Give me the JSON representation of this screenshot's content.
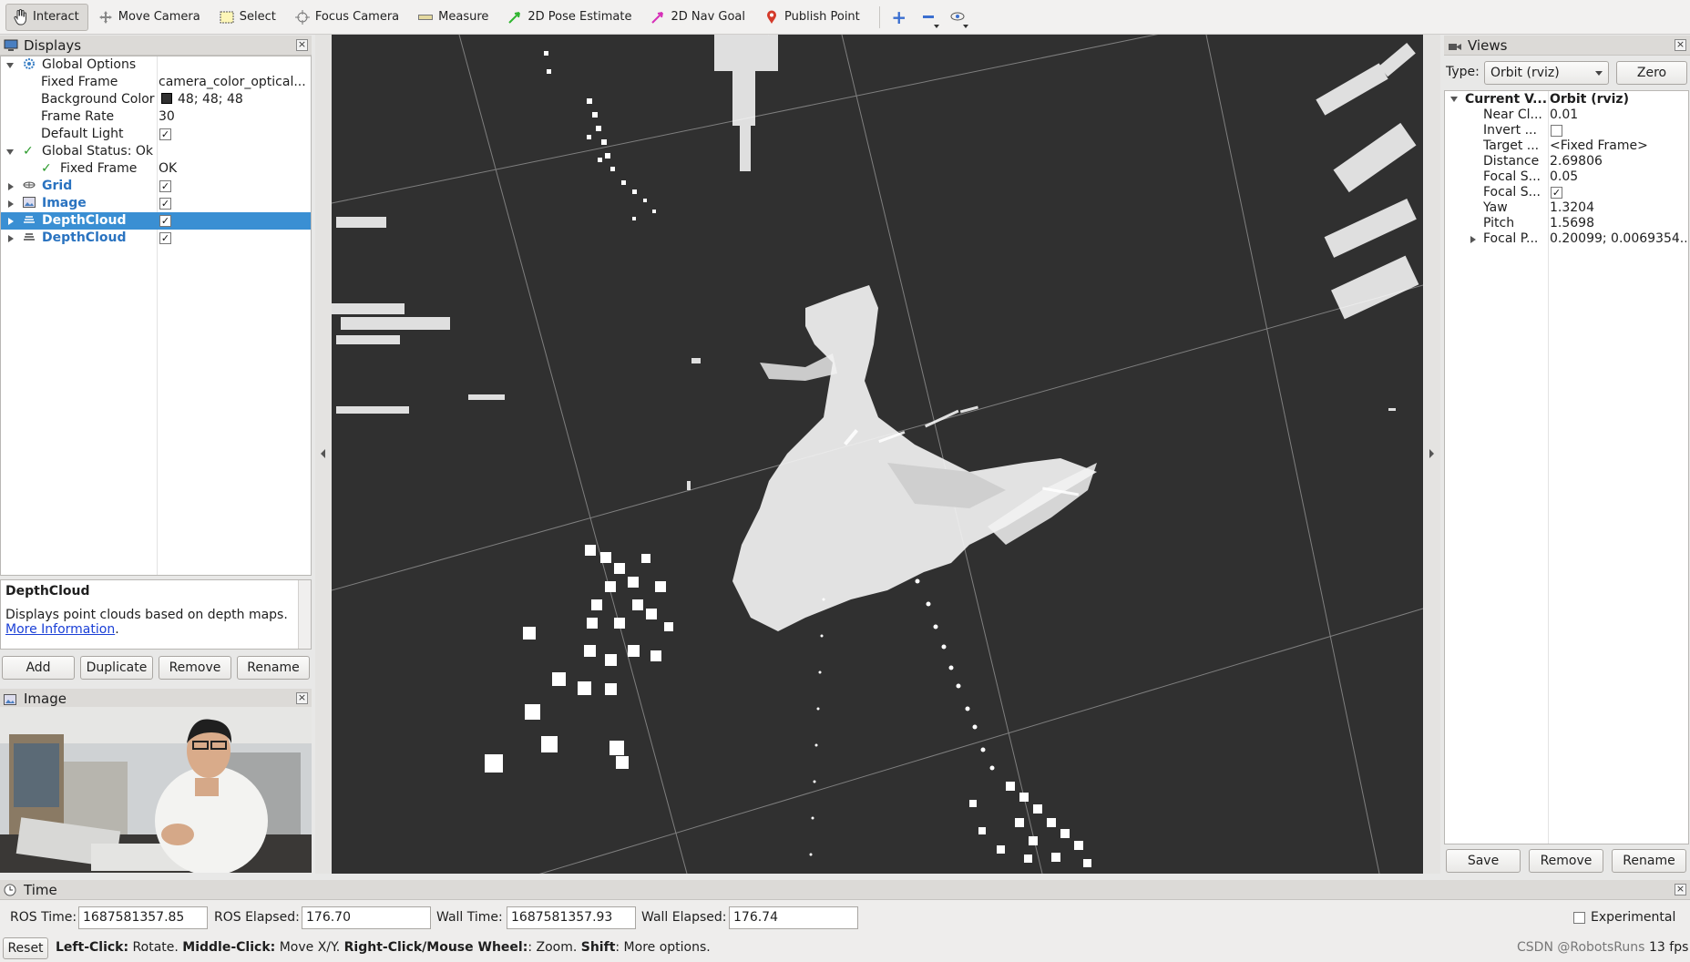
{
  "toolbar": {
    "tools": [
      {
        "label": "Interact",
        "icon": "hand-icon"
      },
      {
        "label": "Move Camera",
        "icon": "move-camera-icon"
      },
      {
        "label": "Select",
        "icon": "select-box-icon"
      },
      {
        "label": "Focus Camera",
        "icon": "focus-target-icon"
      },
      {
        "label": "Measure",
        "icon": "ruler-icon"
      },
      {
        "label": "2D Pose Estimate",
        "icon": "green-arrow-icon"
      },
      {
        "label": "2D Nav Goal",
        "icon": "magenta-arrow-icon"
      },
      {
        "label": "Publish Point",
        "icon": "red-pin-icon"
      }
    ],
    "active_tool": "Interact"
  },
  "displays": {
    "title": "Displays",
    "rows": [
      {
        "key": "Global Options",
        "value": ""
      },
      {
        "key": "Fixed Frame",
        "value": "camera_color_optical..."
      },
      {
        "key": "Background Color",
        "value": "48; 48; 48"
      },
      {
        "key": "Frame Rate",
        "value": "30"
      },
      {
        "key": "Default Light",
        "value": ""
      },
      {
        "key": "Global Status: Ok",
        "value": ""
      },
      {
        "key": "Fixed Frame",
        "value": "OK"
      },
      {
        "key": "Grid",
        "value": ""
      },
      {
        "key": "Image",
        "value": ""
      },
      {
        "key": "DepthCloud",
        "value": ""
      },
      {
        "key": "DepthCloud",
        "value": ""
      }
    ],
    "background_color_swatch": "#303030",
    "selected_row": "DepthCloud"
  },
  "description": {
    "title": "DepthCloud",
    "text": "Displays point clouds based on depth maps.",
    "link": "More Information",
    "link_suffix": "."
  },
  "display_buttons": {
    "add": "Add",
    "duplicate": "Duplicate",
    "remove": "Remove",
    "rename": "Rename"
  },
  "image_panel": {
    "title": "Image"
  },
  "views": {
    "title": "Views",
    "type_label": "Type:",
    "type_value": "Orbit (rviz)",
    "zero": "Zero",
    "rows": [
      {
        "key": "Current V...",
        "value": "Orbit (rviz)"
      },
      {
        "key": "Near Cl...",
        "value": "0.01"
      },
      {
        "key": "Invert ...",
        "value": ""
      },
      {
        "key": "Target ...",
        "value": "<Fixed Frame>"
      },
      {
        "key": "Distance",
        "value": "2.69806"
      },
      {
        "key": "Focal S...",
        "value": "0.05"
      },
      {
        "key": "Focal S...",
        "value": ""
      },
      {
        "key": "Yaw",
        "value": "1.3204"
      },
      {
        "key": "Pitch",
        "value": "1.5698"
      },
      {
        "key": "Focal P...",
        "value": "0.20099; 0.0069354..."
      }
    ],
    "buttons": {
      "save": "Save",
      "remove": "Remove",
      "rename": "Rename"
    }
  },
  "time": {
    "title": "Time",
    "ros_time_label": "ROS Time:",
    "ros_time": "1687581357.85",
    "ros_elapsed_label": "ROS Elapsed:",
    "ros_elapsed": "176.70",
    "wall_time_label": "Wall Time:",
    "wall_time": "1687581357.93",
    "wall_elapsed_label": "Wall Elapsed:",
    "wall_elapsed": "176.74",
    "experimental": "Experimental"
  },
  "status": {
    "reset": "Reset",
    "hint_left_click": "Left-Click:",
    "hint_rotate": " Rotate. ",
    "hint_middle_click": "Middle-Click:",
    "hint_move": " Move X/Y. ",
    "hint_right_click": "Right-Click/Mouse Wheel:",
    "hint_zoom": ": Zoom. ",
    "hint_shift": "Shift",
    "hint_more": ": More options.",
    "fps": "13 fps",
    "watermark": "CSDN @RobotsRuns"
  },
  "colors": {
    "viewport_bg": "#303030",
    "selection": "#3a8fd3",
    "grid": "#a0a0a0"
  }
}
